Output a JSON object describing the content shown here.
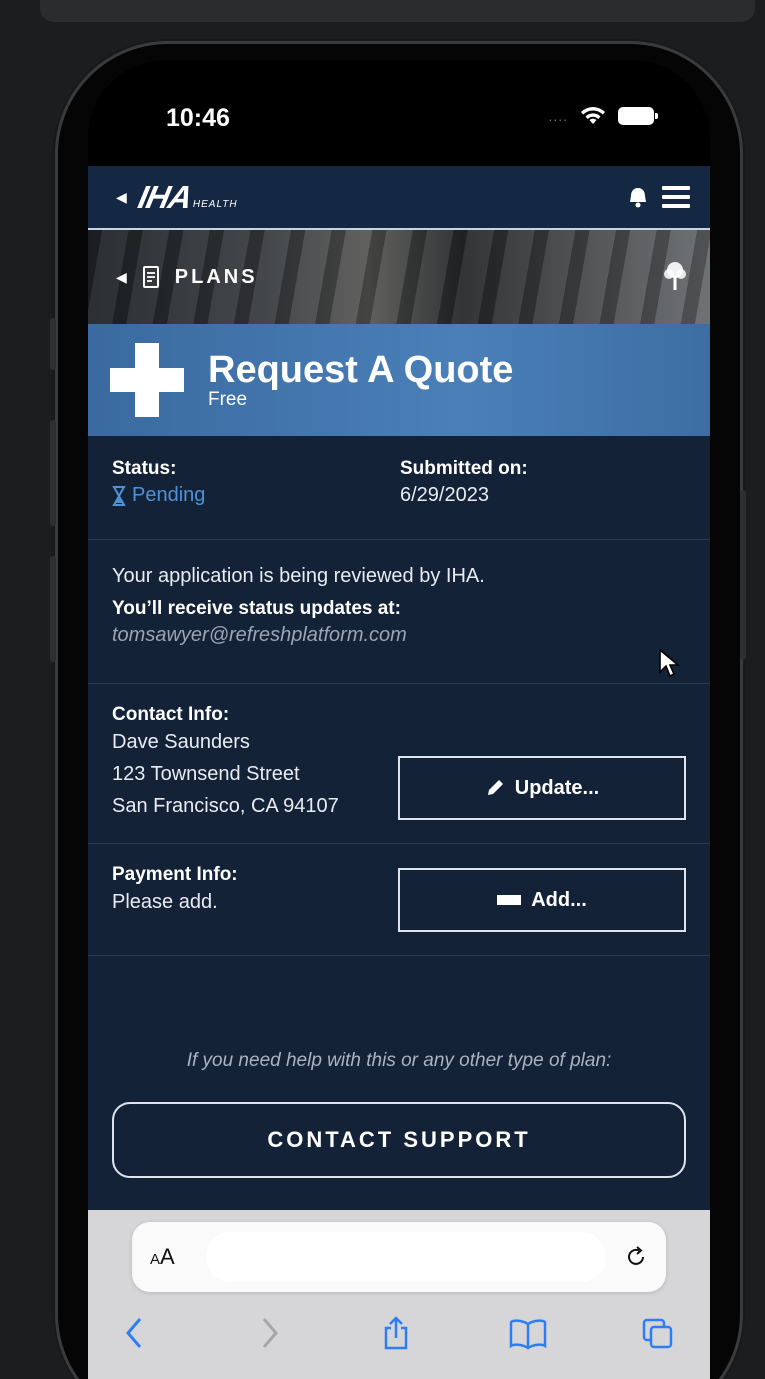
{
  "device": {
    "time": "10:46",
    "signal_dots": "....",
    "icons": {
      "wifi": "wifi-icon",
      "battery": "battery-icon"
    }
  },
  "navbar": {
    "logo_main": "IHA",
    "logo_sub": "HEALTH",
    "icons": [
      "back-icon",
      "bell-icon",
      "hamburger-icon"
    ]
  },
  "banner": {
    "label": "PLANS",
    "icons": [
      "back-icon",
      "document-icon",
      "tree-icon"
    ]
  },
  "quote": {
    "title": "Request A Quote",
    "subtitle": "Free"
  },
  "status": {
    "status_label": "Status:",
    "status_value": "Pending",
    "submitted_label": "Submitted on:",
    "submitted_value": "6/29/2023",
    "status_color": "#4d93d8"
  },
  "review": {
    "message": "Your application is being reviewed by IHA.",
    "updates_label": "You’ll receive status updates at:",
    "email": "tomsawyer@refreshplatform.com"
  },
  "contact": {
    "label": "Contact Info:",
    "name": "Dave Saunders",
    "street": "123 Townsend Street",
    "city": "San Francisco, CA 94107",
    "button_label": "Update..."
  },
  "payment": {
    "label": "Payment Info:",
    "value": "Please add.",
    "button_label": "Add..."
  },
  "help": {
    "text": "If you need help with this or any other type of plan:",
    "button_label": "CONTACT SUPPORT"
  },
  "browser": {
    "text_size_small": "A",
    "text_size_large": "A",
    "icons": [
      "reload-icon",
      "back-arrow-icon",
      "forward-arrow-icon",
      "share-icon",
      "bookmarks-icon",
      "tabs-icon"
    ]
  },
  "colors": {
    "app_bg": "#142238",
    "header_blue": "#4a7fb8",
    "link_blue": "#4d93d8"
  }
}
